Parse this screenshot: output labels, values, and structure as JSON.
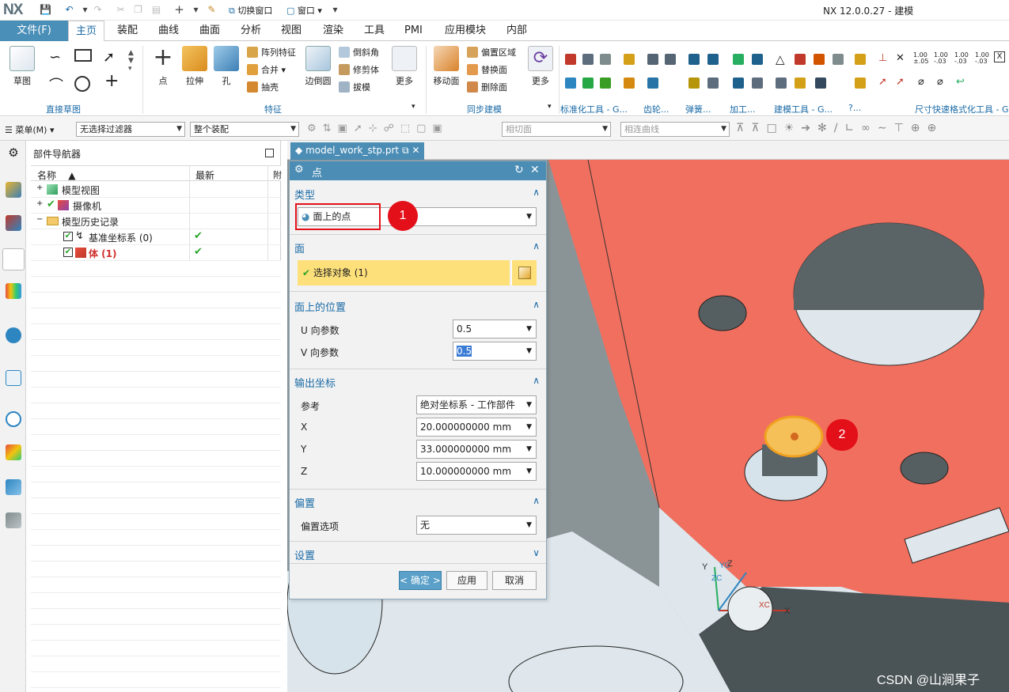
{
  "window": {
    "logo": "NX",
    "title": "NX 12.0.0.27 - 建模"
  },
  "quick_access": {
    "switch_window": "切换窗口",
    "window_menu": "窗口"
  },
  "ribbon_tabs": [
    "文件(F)",
    "主页",
    "装配",
    "曲线",
    "曲面",
    "分析",
    "视图",
    "渲染",
    "工具",
    "PMI",
    "应用模块",
    "内部"
  ],
  "ribbon": {
    "sketch": "草图",
    "direct_sketch_group": "直接草图",
    "point": "点",
    "extrude": "拉伸",
    "hole": "孔",
    "pattern_feature": "阵列特征",
    "unite": "合并",
    "shell": "抽壳",
    "edge_blend": "边倒圆",
    "chamfer": "倒斜角",
    "trim_body": "修剪体",
    "draft": "拔模",
    "more1": "更多",
    "feature_group": "特征",
    "move_face": "移动面",
    "offset_region": "偏置区域",
    "replace_face": "替换面",
    "delete_face": "删除面",
    "more2": "更多",
    "sync_group": "同步建模",
    "std_tools_group": "标准化工具 - G...",
    "gear_group": "齿轮...",
    "spring_group": "弹簧...",
    "machining_group": "加工...",
    "modeling_tools_group": "建模工具 - G...",
    "dim_quick_format_group": "尺寸快速格式化工具 - G..."
  },
  "selection_bar": {
    "menu": "菜单(M)",
    "filter": "无选择过滤器",
    "scope": "整个装配",
    "face_rule": "相切面",
    "curve_rule": "相连曲线"
  },
  "navigator": {
    "title": "部件导航器",
    "col_name": "名称",
    "col_latest": "最新",
    "col_extra": "附",
    "rows": [
      {
        "label": "模型视图",
        "check": ""
      },
      {
        "label": "摄像机",
        "check": ""
      },
      {
        "label": "模型历史记录",
        "check": ""
      },
      {
        "label": "基准坐标系 (0)",
        "check": "✔"
      },
      {
        "label": "体 (1)",
        "check": "✔"
      }
    ]
  },
  "viewport_tab": {
    "filename": "model_work_stp.prt"
  },
  "dialog": {
    "title": "点",
    "type_section": "类型",
    "type_value": "面上的点",
    "face_section": "面",
    "select_object": "选择对象 (1)",
    "position_section": "面上的位置",
    "u_label": "U 向参数",
    "u_value": "0.5",
    "v_label": "V 向参数",
    "v_value": "0.5",
    "output_section": "输出坐标",
    "ref_label": "参考",
    "ref_value": "绝对坐标系 - 工作部件",
    "x_label": "X",
    "x_value": "20.000000000",
    "y_label": "Y",
    "y_value": "33.000000000",
    "z_label": "Z",
    "z_value": "10.000000000",
    "unit": "mm",
    "offset_section": "偏置",
    "offset_label": "偏置选项",
    "offset_value": "无",
    "settings_section": "设置",
    "ok": "< 确定 >",
    "apply": "应用",
    "cancel": "取消"
  },
  "annotations": {
    "badge1": "1",
    "badge2": "2"
  },
  "triad": {
    "xc": "XC",
    "yc": "YC",
    "zc": "ZC",
    "x": "X",
    "y": "Y",
    "z": "Z"
  },
  "watermark": "CSDN @山涧果子",
  "colors": {
    "accent": "#4b8db5",
    "selection": "#ffe07a",
    "part_face": "#f0705f",
    "badge": "#e3101a"
  }
}
